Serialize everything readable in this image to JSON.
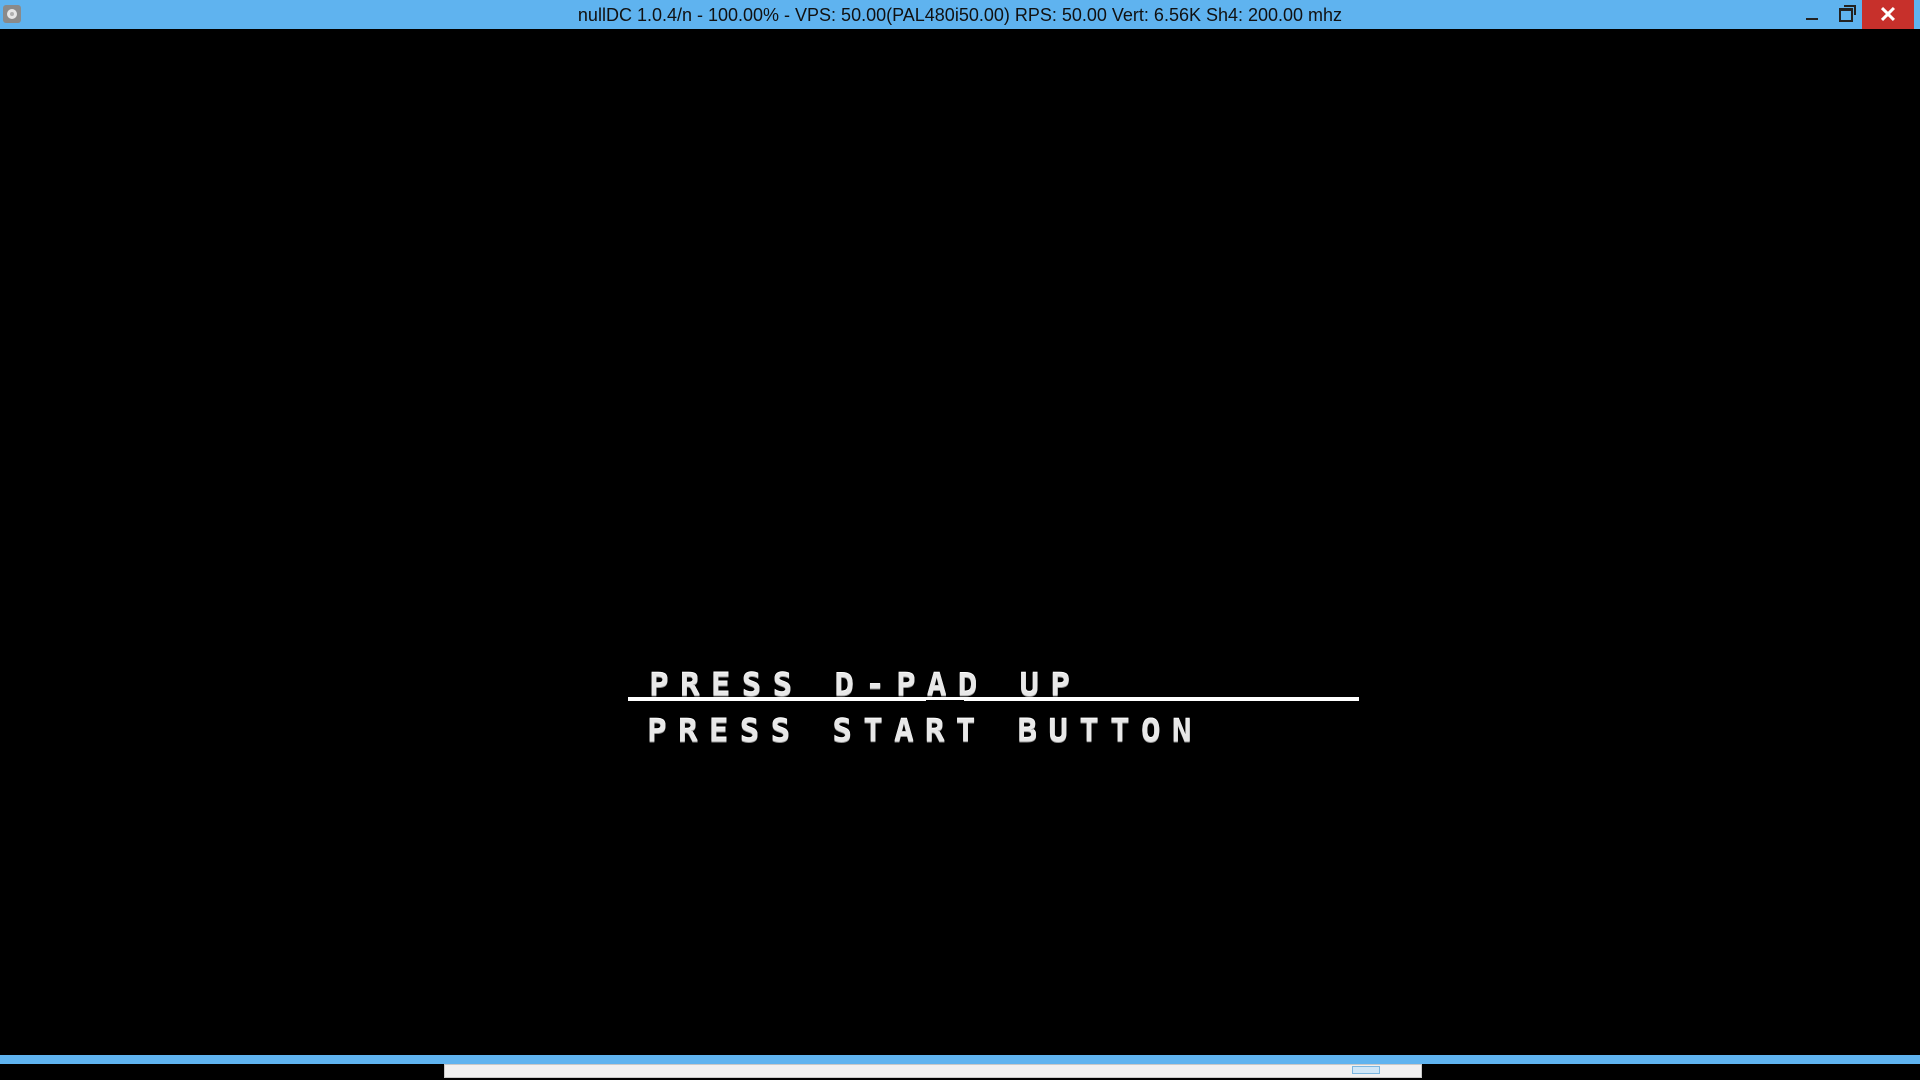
{
  "window": {
    "title": "nullDC 1.0.4/n - 100.00% - VPS: 50.00(PAL480i50.00) RPS: 50.00 Vert: 6.56K Sh4: 200.00 mhz",
    "icon": "nulldc-app-icon",
    "controls": {
      "minimize_icon": "minimize-icon",
      "maximize_icon": "restore-icon",
      "close_icon": "close-icon",
      "close_glyph": "✕"
    },
    "accent_color": "#5fb3ef",
    "close_color": "#c7302b"
  },
  "game_screen": {
    "menu": [
      {
        "text": "PRESS D-PAD UP"
      },
      {
        "text": "PRESS START BUTTON"
      }
    ],
    "text_color": "#e8e8e8",
    "background_color": "#000000"
  },
  "scrollbar": {
    "icon": "horizontal-scrollbar"
  }
}
